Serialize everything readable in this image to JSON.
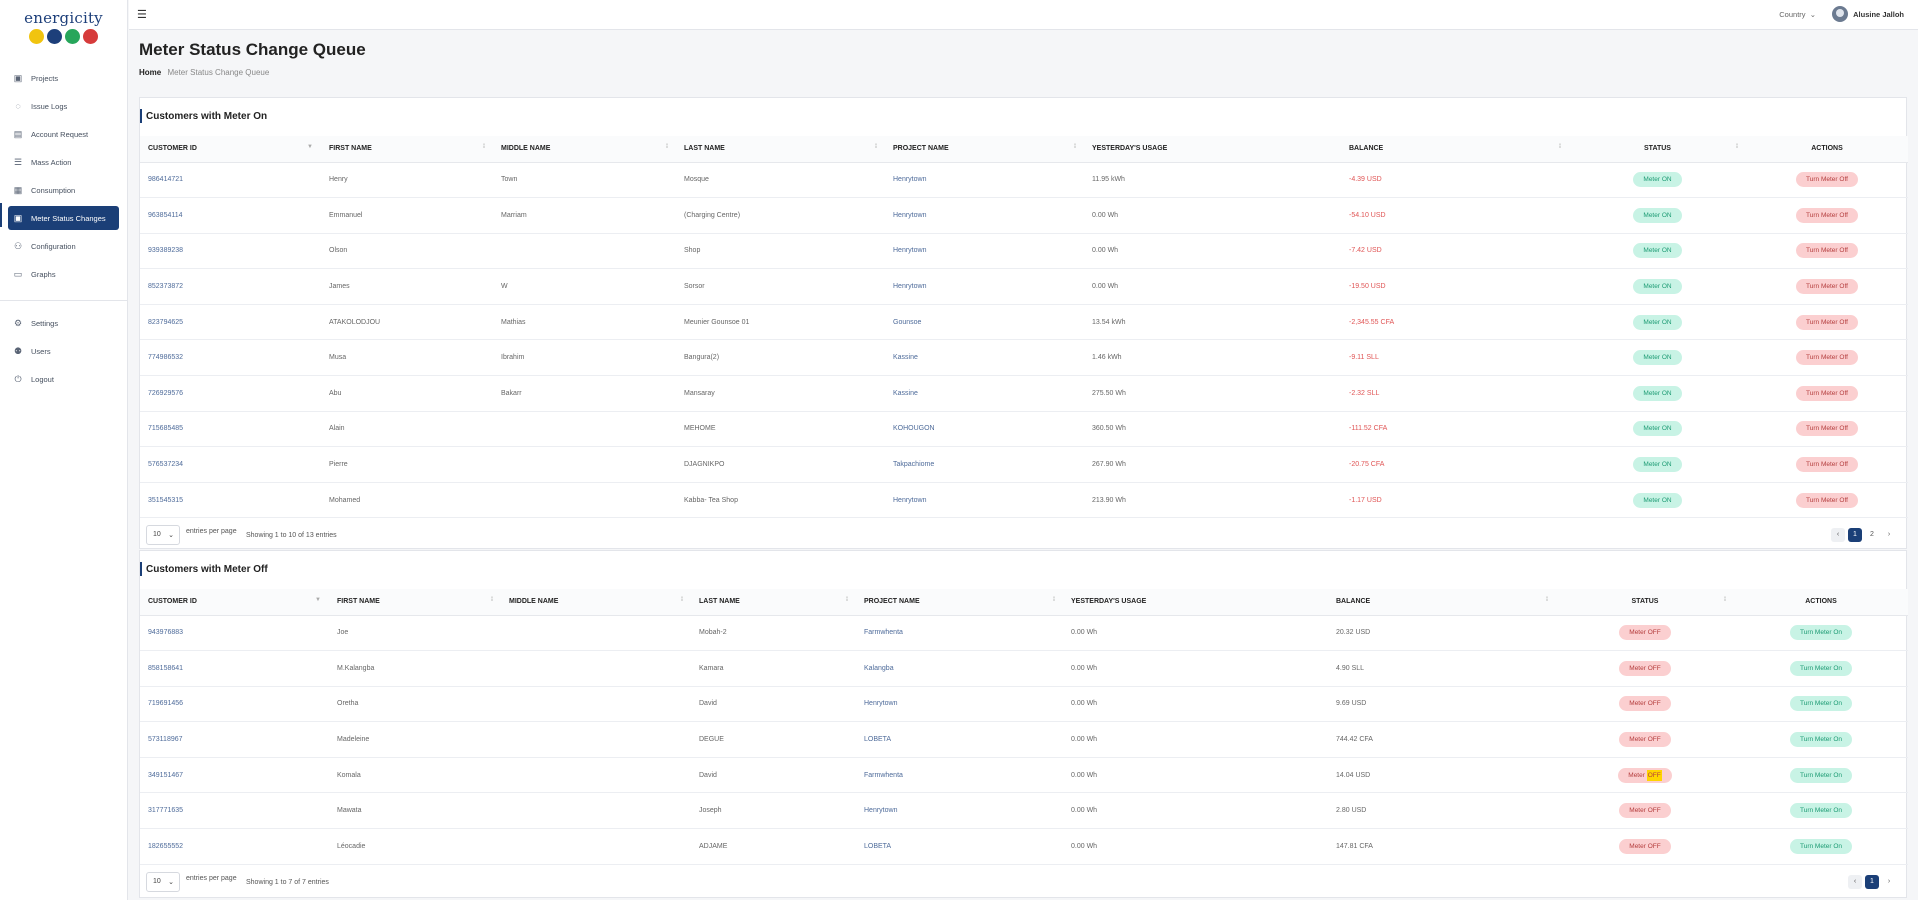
{
  "brand": {
    "name": "energicity",
    "dot_colors": [
      "#f1c40f",
      "#1d3f7a",
      "#27a65b",
      "#d63b3b"
    ]
  },
  "sidebar": {
    "items": [
      {
        "label": "Projects",
        "icon": "clipboard-icon",
        "glyph": "▣"
      },
      {
        "label": "Issue Logs",
        "icon": "warning-icon",
        "glyph": "◌"
      },
      {
        "label": "Account Request",
        "icon": "id-card-icon",
        "glyph": "▤"
      },
      {
        "label": "Mass Action",
        "icon": "list-icon",
        "glyph": "☰"
      },
      {
        "label": "Consumption",
        "icon": "calendar-icon",
        "glyph": "▦"
      },
      {
        "label": "Meter Status Changes",
        "icon": "meter-icon",
        "glyph": "▣"
      },
      {
        "label": "Configuration",
        "icon": "users-icon",
        "glyph": "⚇"
      },
      {
        "label": "Graphs",
        "icon": "graph-icon",
        "glyph": "▭"
      }
    ],
    "bottom_items": [
      {
        "label": "Settings",
        "icon": "gear-icon",
        "glyph": "⚙"
      },
      {
        "label": "Users",
        "icon": "user-group-icon",
        "glyph": "⚉"
      },
      {
        "label": "Logout",
        "icon": "power-icon",
        "glyph": "⏻"
      }
    ]
  },
  "topbar": {
    "country_label": "Country",
    "user_name": "Alusine Jalloh"
  },
  "page": {
    "title": "Meter Status Change Queue",
    "breadcrumb_home": "Home",
    "breadcrumb_current": "Meter Status Change Queue"
  },
  "table_on": {
    "title": "Customers with Meter On",
    "headers": [
      "CUSTOMER ID",
      "FIRST NAME",
      "MIDDLE NAME",
      "LAST NAME",
      "PROJECT NAME",
      "YESTERDAY'S USAGE",
      "BALANCE",
      "STATUS",
      "ACTIONS"
    ],
    "status_label": "Meter ON",
    "action_label": "Turn Meter Off",
    "rows": [
      [
        "986414721",
        "Henry",
        "Town",
        "Mosque",
        "Henrytown",
        "11.95 kWh",
        "-4.39 USD"
      ],
      [
        "963854114",
        "Emmanuel",
        "Marriam",
        "(Charging Centre)",
        "Henrytown",
        "0.00 Wh",
        "-54.10 USD"
      ],
      [
        "939389238",
        "Olson",
        "",
        "Shop",
        "Henrytown",
        "0.00 Wh",
        "-7.42 USD"
      ],
      [
        "852373872",
        "James",
        "W",
        "Sorsor",
        "Henrytown",
        "0.00 Wh",
        "-19.50 USD"
      ],
      [
        "823794625",
        "ATAKOLODJOU",
        "Mathias",
        "Meunier Gounsoe 01",
        "Gounsoe",
        "13.54 kWh",
        "-2,345.55 CFA"
      ],
      [
        "774986532",
        "Musa",
        "Ibrahim",
        "Bangura(2)",
        "Kassine",
        "1.46 kWh",
        "-9.11 SLL"
      ],
      [
        "726929576",
        "Abu",
        "Bakarr",
        "Mansaray",
        "Kassine",
        "275.50 Wh",
        "-2.32 SLL"
      ],
      [
        "715685485",
        "Alain",
        "",
        "MEHOME",
        "KOHOUGON",
        "360.50 Wh",
        "-111.52 CFA"
      ],
      [
        "576537234",
        "Pierre",
        "",
        "DJAGNIKPO",
        "Takpachiome",
        "267.90 Wh",
        "-20.75 CFA"
      ],
      [
        "351545315",
        "Mohamed",
        "",
        "Kabba- Tea Shop",
        "Henrytown",
        "213.90 Wh",
        "-1.17 USD"
      ]
    ],
    "page_size": "10",
    "per_page_label": "entries per page",
    "showing": "Showing 1 to 10 of 13 entries",
    "pages": [
      "1",
      "2"
    ]
  },
  "table_off": {
    "title": "Customers with Meter Off",
    "headers": [
      "CUSTOMER ID",
      "FIRST NAME",
      "MIDDLE NAME",
      "LAST NAME",
      "PROJECT NAME",
      "YESTERDAY'S USAGE",
      "BALANCE",
      "STATUS",
      "ACTIONS"
    ],
    "status_label": "Meter OFF",
    "action_label": "Turn Meter On",
    "rows": [
      [
        "943976883",
        "Joe",
        "",
        "Mobah-2",
        "Farmwhenta",
        "0.00 Wh",
        "20.32 USD"
      ],
      [
        "858158641",
        "M.Kalangba",
        "",
        "Kamara",
        "Kalangba",
        "0.00 Wh",
        "4.90 SLL"
      ],
      [
        "719691456",
        "Oretha",
        "",
        "David",
        "Henrytown",
        "0.00 Wh",
        "9.69 USD"
      ],
      [
        "573118967",
        "Madeleine",
        "",
        "DEGUE",
        "LOBETA",
        "0.00 Wh",
        "744.42 CFA"
      ],
      [
        "349151467",
        "Komala",
        "",
        "David",
        "Farmwhenta",
        "0.00 Wh",
        "14.04 USD"
      ],
      [
        "317771635",
        "Mawata",
        "",
        "Joseph",
        "Henrytown",
        "0.00 Wh",
        "2.80 USD"
      ],
      [
        "182655552",
        "Léocadie",
        "",
        "ADJAME",
        "LOBETA",
        "0.00 Wh",
        "147.81 CFA"
      ]
    ],
    "page_size": "10",
    "per_page_label": "entries per page",
    "showing": "Showing 1 to 7 of 7 entries",
    "pages": [
      "1"
    ]
  }
}
